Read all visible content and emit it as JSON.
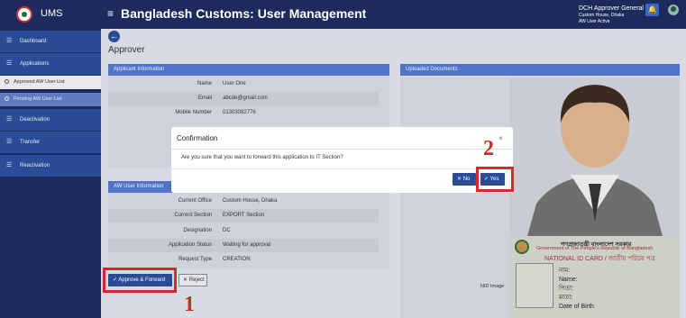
{
  "header": {
    "app_name": "UMS",
    "page_heading": "Bangladesh Customs: User Management",
    "user_name": "DCH Approver General",
    "user_office": "Custom House, Dhaka",
    "user_status": "AW User Active"
  },
  "sidebar": {
    "items": [
      {
        "label": "Dashboard"
      },
      {
        "label": "Applications"
      },
      {
        "label": "Approved AW User List"
      },
      {
        "label": "Pending AW User List"
      },
      {
        "label": "Deactivation"
      },
      {
        "label": "Transfer"
      },
      {
        "label": "Reactivation"
      }
    ]
  },
  "main": {
    "title": "Approver",
    "applicant_section": "Applicant Information",
    "applicant_rows": [
      {
        "key": "Name",
        "value": "User One"
      },
      {
        "key": "Email",
        "value": "abcde@gmail.com"
      },
      {
        "key": "Mobile Number",
        "value": "01303082776"
      }
    ],
    "aw_section": "AW User Information",
    "aw_rows": [
      {
        "key": "Current Office",
        "value": "Custom House, Dhaka"
      },
      {
        "key": "Current Section",
        "value": "EXPORT Section"
      },
      {
        "key": "Designation",
        "value": "DC"
      },
      {
        "key": "Application Status",
        "value": "Waiting for approval"
      },
      {
        "key": "Request Type",
        "value": "CREATION"
      }
    ],
    "docs_section": "Uploaded Documents",
    "nid_label": "NID Image",
    "approve_label": "Approve & Forward",
    "reject_label": "Reject"
  },
  "nid": {
    "line1": "গণপ্রজাতন্ত্রী বাংলাদেশ সরকার",
    "line2": "Government of The People's Republic of Bangladesh",
    "line3": "NATIONAL ID CARD / জাতীয় পরিচয় পত্র",
    "fields": [
      "নাম:",
      "Name:",
      "পিতা:",
      "মাতা:",
      "Date of Birth"
    ]
  },
  "modal": {
    "title": "Confirmation",
    "close": "×",
    "body": "Are you sure that you want to forward this application to IT Section?",
    "no_label": "No",
    "yes_label": "Yes"
  },
  "annotations": {
    "mark1": "1",
    "mark2": "2",
    "color": "#d42a2a"
  }
}
